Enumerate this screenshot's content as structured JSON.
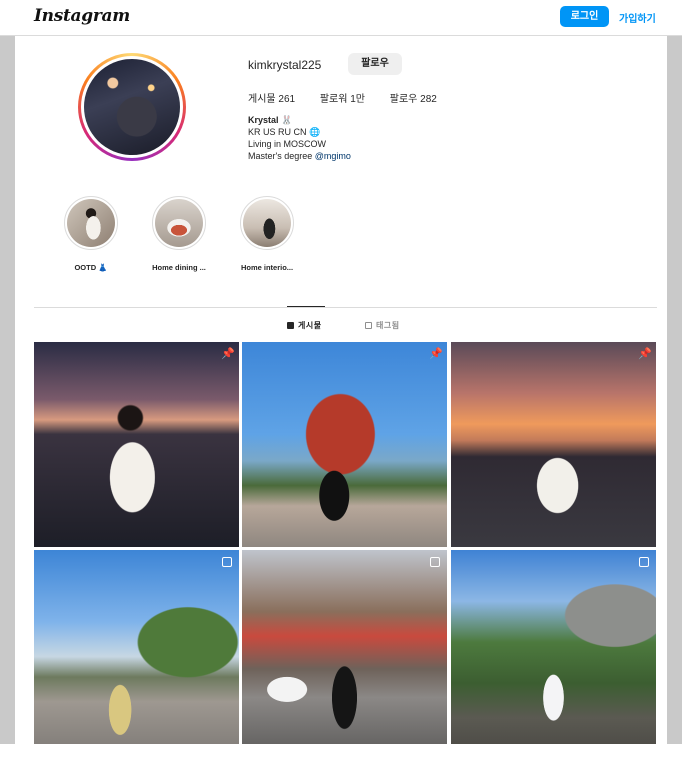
{
  "header": {
    "logo": "Instagram",
    "login_label": "로그인",
    "signup_label": "가입하기"
  },
  "profile": {
    "username": "kimkrystal225",
    "follow_label": "팔로우",
    "stats": {
      "posts": "게시물 261",
      "followers": "팔로워 1만",
      "following": "팔로우 282"
    },
    "bio": {
      "name": "Krystal 🐰",
      "line1": "KR US RU CN 🌐",
      "line2": "Living in MOSCOW",
      "line3_prefix": "Master's degree ",
      "line3_mention": "@mgimo"
    }
  },
  "highlights": [
    {
      "label": "OOTD 👗"
    },
    {
      "label": "Home dining ..."
    },
    {
      "label": "Home interio..."
    }
  ],
  "tabs": {
    "posts": "게시물",
    "tagged": "태그됨"
  },
  "colors": {
    "accent": "#0095f6",
    "mention": "#00376b"
  },
  "posts": [
    {
      "badge": "pin-icon"
    },
    {
      "badge": "pin-icon"
    },
    {
      "badge": "pin-icon"
    },
    {
      "badge": "multiple-photos-icon"
    },
    {
      "badge": "multiple-photos-icon"
    },
    {
      "badge": "multiple-photos-icon"
    }
  ]
}
